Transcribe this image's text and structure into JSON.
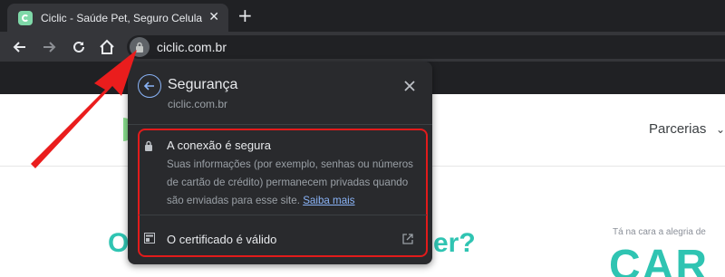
{
  "browser": {
    "tab": {
      "title": "Ciclic - Saúde Pet, Seguro Celular",
      "icon": "ciclic-favicon-icon"
    },
    "omnibox": {
      "url": "ciclic.com.br"
    }
  },
  "page": {
    "nav_link": "Parcerias",
    "hero_left": "O",
    "hero_right": "er?",
    "tagline": "Tá na cara a alegria de",
    "big_word": "CAR"
  },
  "security_popup": {
    "title": "Segurança",
    "domain": "ciclic.com.br",
    "connection_title": "A conexão é segura",
    "connection_desc": "Suas informações (por exemplo, senhas ou números de cartão de crédito) permanecem privadas quando são enviadas para esse site.",
    "learn_more": "Saiba mais",
    "certificate_label": "O certificado é válido"
  },
  "colors": {
    "accent_blue": "#8ab4f8",
    "highlight_red": "#e21b1b",
    "brand_teal": "#2fc4b2"
  }
}
